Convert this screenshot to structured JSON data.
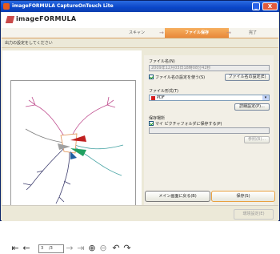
{
  "window": {
    "title": "imageFORMULA CaptureOnTouch Lite",
    "minimize_label": "_",
    "close_label": "X"
  },
  "header": {
    "logo_text": "imageFORMULA"
  },
  "steps": {
    "scan": "スキャン",
    "save": "ファイル保存",
    "done": "完了",
    "arrow": "→"
  },
  "instruction": "出力の設定をしてください",
  "preview": {
    "page_current": "3",
    "page_total": "/3",
    "nav_icons": [
      "first-page-icon",
      "prev-page-icon",
      "next-page-icon",
      "last-page-icon",
      "zoom-in-icon",
      "zoom-out-icon",
      "rotate-left-icon",
      "rotate-right-icon"
    ]
  },
  "file_name": {
    "label": "ファイル名(N)",
    "value": "2009年12月03日18時08分42秒",
    "checkbox_label": "ファイル名の設定を使う(S)",
    "button": "ファイル名の設定(E)"
  },
  "file_format": {
    "label": "ファイル形式(T)",
    "value": "PDF",
    "button": "詳細設定(P)..."
  },
  "save_location": {
    "label": "保存場所",
    "checkbox_label": "マイ ピクチャフォルダに保存する(P)",
    "value": "",
    "button": "参照(B)..."
  },
  "footer": {
    "back_button": "メイン画面に戻る(B)",
    "save_button": "保存(S)"
  },
  "statusbar": {
    "hint": "環境設定(E)"
  },
  "colors": {
    "accent": "#e8883a",
    "titlebar": "#0a46c8"
  }
}
